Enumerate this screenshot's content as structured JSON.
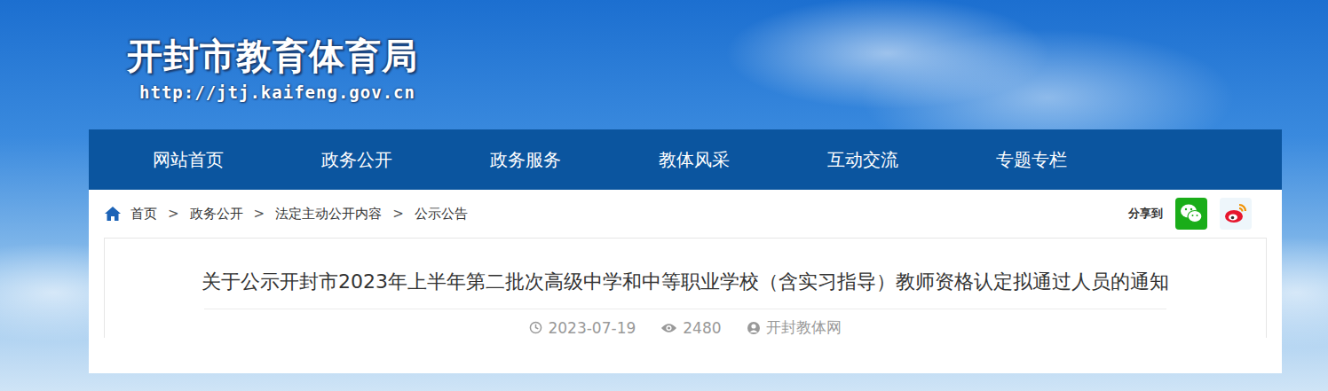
{
  "site": {
    "title": "开封市教育体育局",
    "url": "http://jtj.kaifeng.gov.cn"
  },
  "nav": [
    "网站首页",
    "政务公开",
    "政务服务",
    "教体风采",
    "互动交流",
    "专题专栏"
  ],
  "breadcrumb": {
    "items": [
      "首页",
      "政务公开",
      "法定主动公开内容",
      "公示公告"
    ],
    "separator": ">"
  },
  "share": {
    "label": "分享到"
  },
  "article": {
    "title": "关于公示开封市2023年上半年第二批次高级中学和中等职业学校（含实习指导）教师资格认定拟通过人员的通知",
    "date": "2023-07-19",
    "views": "2480",
    "source": "开封教体网"
  }
}
